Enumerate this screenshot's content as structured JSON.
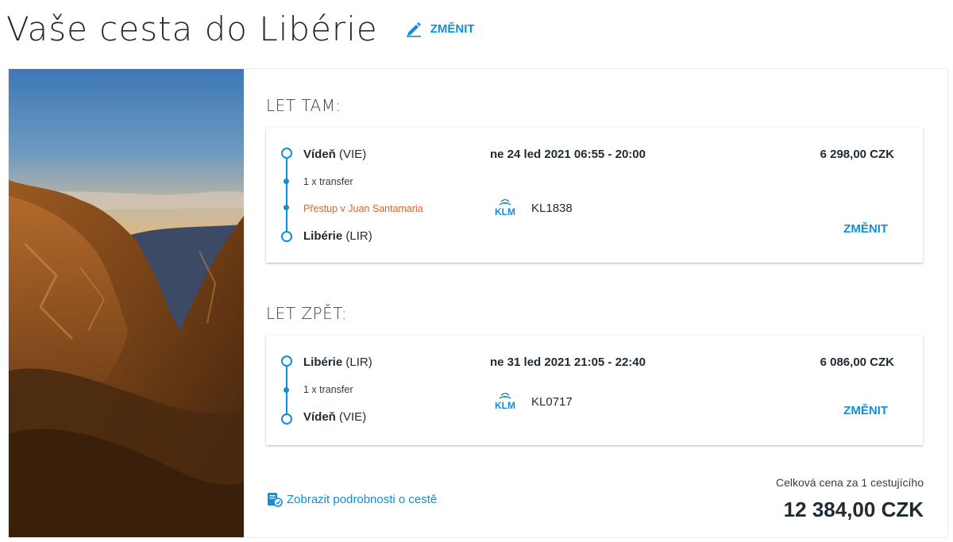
{
  "header": {
    "title": "Vaše cesta do Libérie",
    "edit_label": "ZMĚNIT"
  },
  "outbound": {
    "title": "LET TAM:",
    "from_city": "Vídeň",
    "from_code": "(VIE)",
    "transfer": "1 x transfer",
    "stopover": "Přestup v Juan Santamaria",
    "to_city": "Libérie",
    "to_code": "(LIR)",
    "date_time": "ne 24 led 2021  06:55 - 20:00",
    "airline_logo": "KLM",
    "flight_number": "KL1838",
    "price": "6 298,00 CZK",
    "change_label": "ZMĚNIT"
  },
  "return": {
    "title": "LET ZPĚT:",
    "from_city": "Libérie",
    "from_code": "(LIR)",
    "transfer": "1 x transfer",
    "to_city": "Vídeň",
    "to_code": "(VIE)",
    "date_time": "ne 31 led 2021  21:05 - 22:40",
    "airline_logo": "KLM",
    "flight_number": "KL0717",
    "price": "6 086,00 CZK",
    "change_label": "ZMĚNIT"
  },
  "footer": {
    "details_link": "Zobrazit podrobnosti o cestě",
    "total_label": "Celková cena za 1 cestujícího",
    "total_price": "12 384,00 CZK"
  },
  "colors": {
    "accent": "#0e8fd6",
    "stopover": "#e0652e",
    "text": "#1f2a33"
  },
  "icons": [
    "pencil-icon",
    "klm-logo",
    "trip-details-icon"
  ]
}
